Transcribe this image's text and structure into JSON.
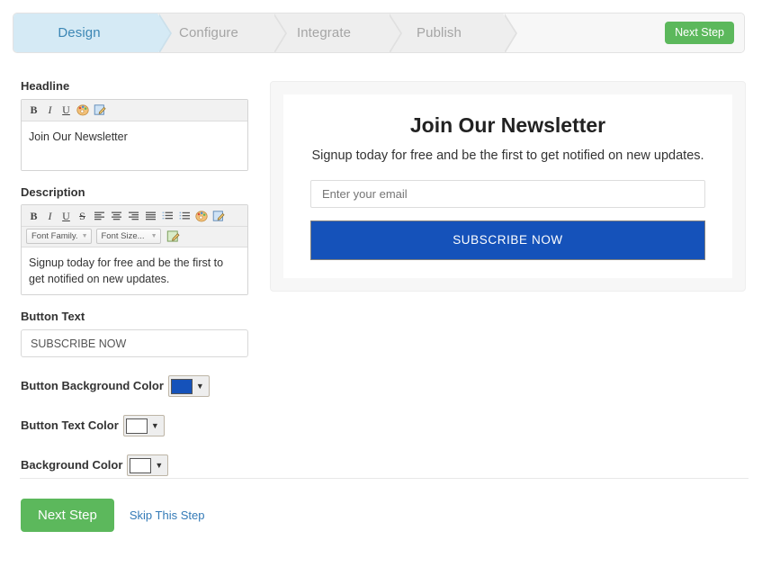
{
  "wizard": {
    "steps": [
      {
        "label": "Design",
        "active": true
      },
      {
        "label": "Configure",
        "active": false
      },
      {
        "label": "Integrate",
        "active": false
      },
      {
        "label": "Publish",
        "active": false
      }
    ],
    "next_step_label": "Next Step",
    "active_bg": "#d5eaf5",
    "active_text": "#3c87b5",
    "inactive_bg": "#eeeeee",
    "inactive_text": "#a5a5a5",
    "button_color": "#5cb85c"
  },
  "form": {
    "headline": {
      "label": "Headline",
      "value": "Join Our Newsletter",
      "toolbar": [
        {
          "name": "bold-icon",
          "glyph": "B"
        },
        {
          "name": "italic-icon",
          "glyph": "I"
        },
        {
          "name": "underline-icon",
          "glyph": "U"
        },
        {
          "name": "color-palette-icon",
          "glyph": ""
        },
        {
          "name": "source-edit-icon",
          "glyph": ""
        }
      ]
    },
    "description": {
      "label": "Description",
      "value": "Signup today for free and be the first to get notified on new updates.",
      "toolbar": [
        {
          "name": "bold-icon",
          "glyph": "B"
        },
        {
          "name": "italic-icon",
          "glyph": "I"
        },
        {
          "name": "underline-icon",
          "glyph": "U"
        },
        {
          "name": "strikethrough-icon",
          "glyph": "S"
        },
        {
          "name": "align-left-icon",
          "glyph": ""
        },
        {
          "name": "align-center-icon",
          "glyph": ""
        },
        {
          "name": "align-right-icon",
          "glyph": ""
        },
        {
          "name": "align-justify-icon",
          "glyph": ""
        },
        {
          "name": "ordered-list-icon",
          "glyph": ""
        },
        {
          "name": "unordered-list-icon",
          "glyph": ""
        },
        {
          "name": "color-palette-icon",
          "glyph": ""
        },
        {
          "name": "source-edit-icon",
          "glyph": ""
        }
      ],
      "font_family_label": "Font Family.",
      "font_size_label": "Font Size..."
    },
    "button_text": {
      "label": "Button Text",
      "value": "SUBSCRIBE NOW"
    },
    "button_background_color": {
      "label": "Button Background Color",
      "value": "#1552ba"
    },
    "button_text_color": {
      "label": "Button Text Color",
      "value": "#ffffff"
    },
    "background_color": {
      "label": "Background Color",
      "value": "#ffffff"
    }
  },
  "preview": {
    "headline": "Join Our Newsletter",
    "description": "Signup today for free and be the first to get notified on new updates.",
    "email_placeholder": "Enter your email",
    "button_label": "SUBSCRIBE NOW",
    "button_bg": "#1552ba",
    "button_text_color": "#ffffff",
    "card_bg": "#ffffff",
    "panel_bg": "#f7f7f7"
  },
  "footer": {
    "next_step_label": "Next Step",
    "skip_label": "Skip This Step",
    "link_color": "#337ab7"
  }
}
